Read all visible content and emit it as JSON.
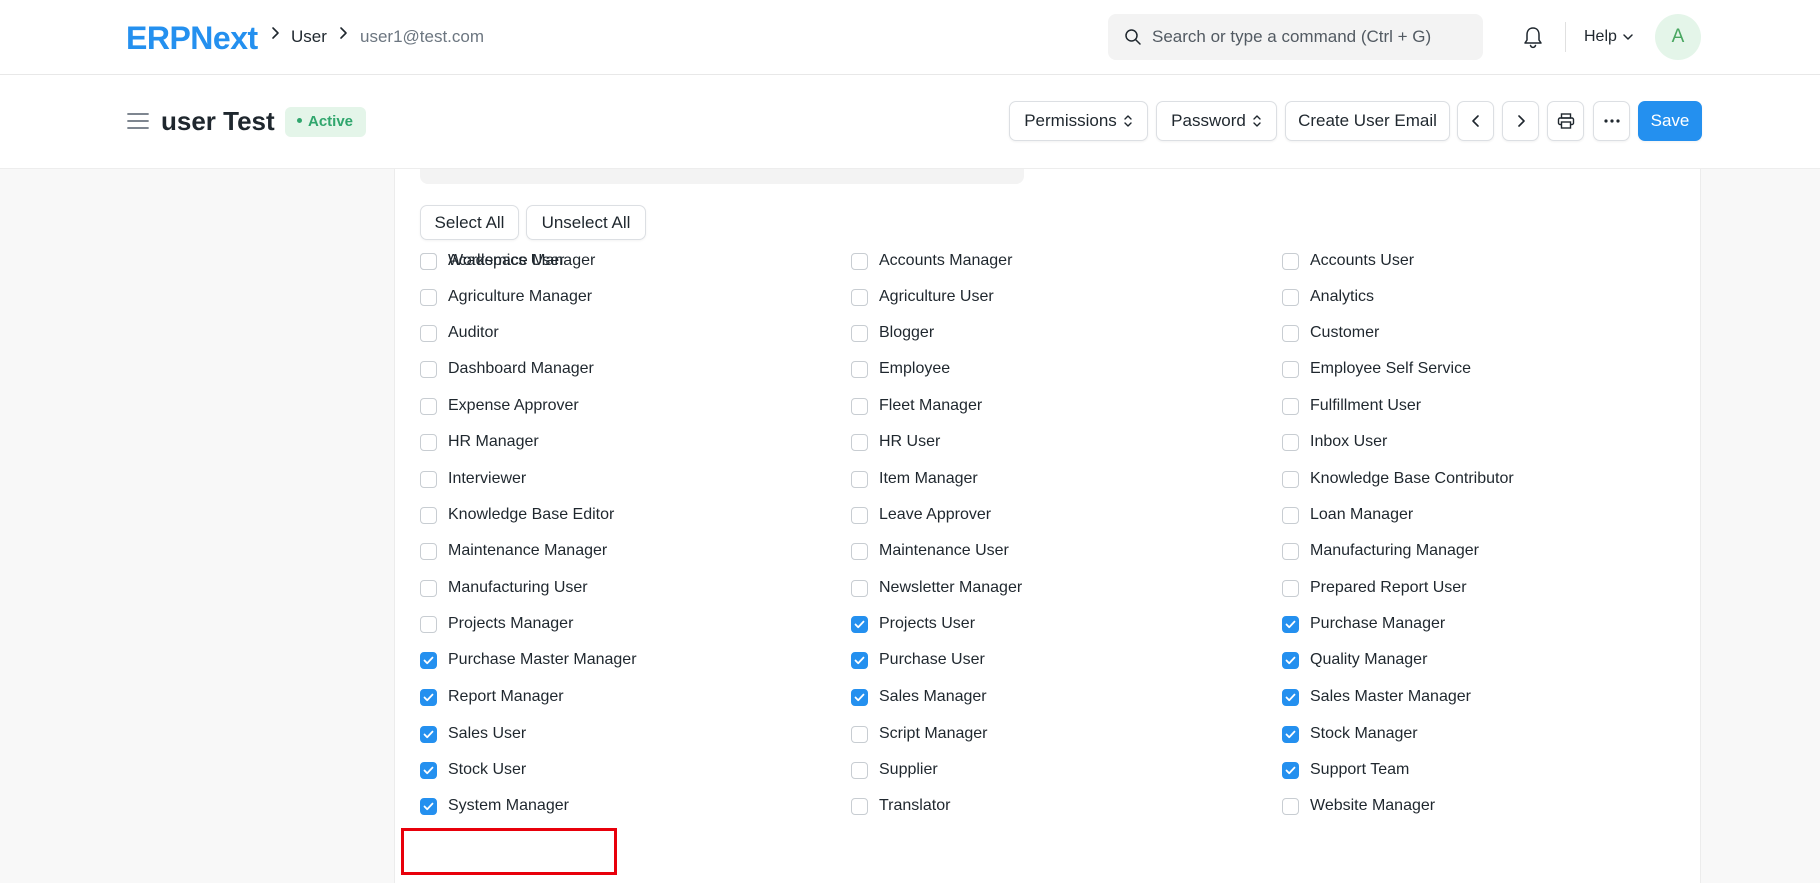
{
  "navbar": {
    "logo_text": "ERPNext",
    "breadcrumbs": [
      "User",
      "user1@test.com"
    ],
    "search_placeholder": "Search or type a command (Ctrl + G)",
    "help_label": "Help",
    "avatar_initial": "A"
  },
  "page_head": {
    "title": "user Test",
    "status": "Active",
    "buttons": {
      "permissions": "Permissions",
      "password": "Password",
      "create_user_email": "Create User Email",
      "save": "Save"
    }
  },
  "roles": {
    "select_all": "Select All",
    "unselect_all": "Unselect All",
    "items": [
      {
        "label": "Academics User",
        "checked": false
      },
      {
        "label": "Accounts Manager",
        "checked": false
      },
      {
        "label": "Accounts User",
        "checked": false
      },
      {
        "label": "Agriculture Manager",
        "checked": false
      },
      {
        "label": "Agriculture User",
        "checked": false
      },
      {
        "label": "Analytics",
        "checked": false
      },
      {
        "label": "Auditor",
        "checked": false
      },
      {
        "label": "Blogger",
        "checked": false
      },
      {
        "label": "Customer",
        "checked": false
      },
      {
        "label": "Dashboard Manager",
        "checked": false
      },
      {
        "label": "Employee",
        "checked": false
      },
      {
        "label": "Employee Self Service",
        "checked": false
      },
      {
        "label": "Expense Approver",
        "checked": false
      },
      {
        "label": "Fleet Manager",
        "checked": false
      },
      {
        "label": "Fulfillment User",
        "checked": false
      },
      {
        "label": "HR Manager",
        "checked": false
      },
      {
        "label": "HR User",
        "checked": false
      },
      {
        "label": "Inbox User",
        "checked": false
      },
      {
        "label": "Interviewer",
        "checked": false
      },
      {
        "label": "Item Manager",
        "checked": false
      },
      {
        "label": "Knowledge Base Contributor",
        "checked": false
      },
      {
        "label": "Knowledge Base Editor",
        "checked": false
      },
      {
        "label": "Leave Approver",
        "checked": false
      },
      {
        "label": "Loan Manager",
        "checked": false
      },
      {
        "label": "Maintenance Manager",
        "checked": false
      },
      {
        "label": "Maintenance User",
        "checked": false
      },
      {
        "label": "Manufacturing Manager",
        "checked": false
      },
      {
        "label": "Manufacturing User",
        "checked": false
      },
      {
        "label": "Newsletter Manager",
        "checked": false
      },
      {
        "label": "Prepared Report User",
        "checked": false
      },
      {
        "label": "Projects Manager",
        "checked": false
      },
      {
        "label": "Projects User",
        "checked": true
      },
      {
        "label": "Purchase Manager",
        "checked": true
      },
      {
        "label": "Purchase Master Manager",
        "checked": true
      },
      {
        "label": "Purchase User",
        "checked": true
      },
      {
        "label": "Quality Manager",
        "checked": true
      },
      {
        "label": "Report Manager",
        "checked": true
      },
      {
        "label": "Sales Manager",
        "checked": true
      },
      {
        "label": "Sales Master Manager",
        "checked": true
      },
      {
        "label": "Sales User",
        "checked": true
      },
      {
        "label": "Script Manager",
        "checked": false
      },
      {
        "label": "Stock Manager",
        "checked": true
      },
      {
        "label": "Stock User",
        "checked": true
      },
      {
        "label": "Supplier",
        "checked": false
      },
      {
        "label": "Support Team",
        "checked": true
      },
      {
        "label": "System Manager",
        "checked": true
      },
      {
        "label": "Translator",
        "checked": false
      },
      {
        "label": "Website Manager",
        "checked": false
      },
      {
        "label": "Workspace Manager",
        "checked": false
      }
    ]
  },
  "colors": {
    "accent": "#2490ef",
    "highlight": "#e8000b"
  }
}
